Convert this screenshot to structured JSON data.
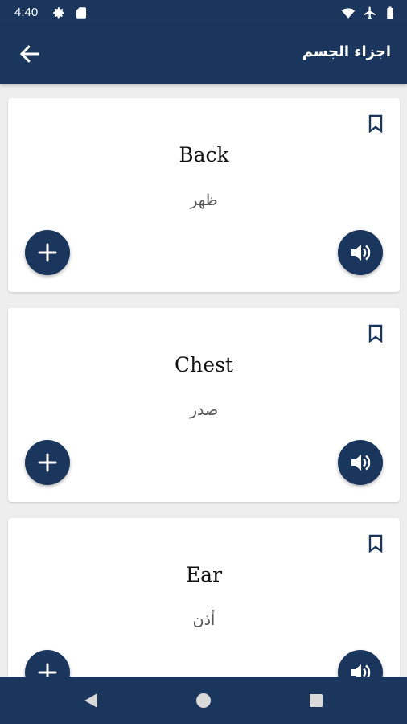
{
  "status_bar": {
    "time": "4:40",
    "left_icons": [
      "settings-gear-icon",
      "sd-card-icon"
    ],
    "right_icons": [
      "wifi-icon",
      "airplane-mode-icon",
      "battery-icon"
    ]
  },
  "app_bar": {
    "title": "اجزاء الجسم",
    "back_icon": "arrow-left-icon"
  },
  "colors": {
    "primary": "#1b365d",
    "background": "#eeeeee",
    "card": "#ffffff"
  },
  "cards": [
    {
      "word": "Back",
      "translation": "ظهر"
    },
    {
      "word": "Chest",
      "translation": "صدر"
    },
    {
      "word": "Ear",
      "translation": "أذن"
    }
  ],
  "card_icons": {
    "bookmark": "bookmark-outline-icon",
    "add": "plus-icon",
    "sound": "speaker-volume-icon"
  },
  "nav_bar": {
    "icons": [
      "nav-back-triangle-icon",
      "nav-home-circle-icon",
      "nav-recents-square-icon"
    ]
  }
}
